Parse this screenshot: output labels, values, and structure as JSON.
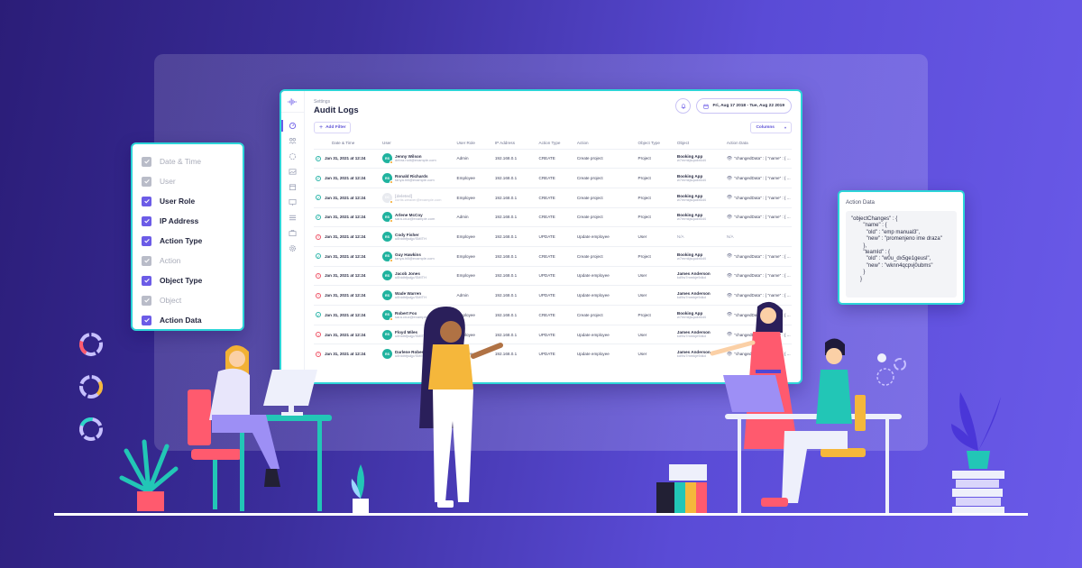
{
  "app": {
    "breadcrumb": "Settings",
    "title": "Audit Logs",
    "date_range": "Fri, Aug 17 2018 - Tue, Aug 22 2019",
    "add_filter_label": "Add Filter",
    "columns_label": "Columns",
    "sidebar_icons": [
      "dashboard-icon",
      "users-icon",
      "integrations-icon",
      "gallery-icon",
      "calendar-icon",
      "display-icon",
      "list-icon",
      "briefcase-icon",
      "settings-icon"
    ],
    "accent": "#6c5ce7",
    "status_colors": {
      "success": "#2bb5a9",
      "warning": "#ef5366"
    }
  },
  "table": {
    "columns": [
      "Date & Time",
      "User",
      "User Role",
      "IP Address",
      "Action Type",
      "Action",
      "Object Type",
      "Object",
      "Action Data"
    ],
    "rows": [
      {
        "status": "success",
        "datetime": "Jan 31, 2021 at 12:24",
        "initials": "RS",
        "user": "Jenny Wilson",
        "email": "debra.holt@example.com",
        "flag": true,
        "deleted": false,
        "role": "Admin",
        "ip": "192.168.0.1",
        "action_type": "CREATE",
        "action": "Create project",
        "object_type": "Project",
        "object": "Booking App",
        "object_id": "w7mmkjsqudx6d4",
        "action_data": "\"changedData\" : { \"name\" : { ..."
      },
      {
        "status": "success",
        "datetime": "Jan 31, 2021 at 12:24",
        "initials": "RS",
        "user": "Ronald Richards",
        "email": "tanya.hill@example.com",
        "flag": true,
        "deleted": false,
        "role": "Employee",
        "ip": "192.168.0.1",
        "action_type": "CREATE",
        "action": "Create project",
        "object_type": "Project",
        "object": "Booking App",
        "object_id": "w7mmkjsqudx6d4",
        "action_data": "\"changedData\" : { \"name\" : { ..."
      },
      {
        "status": "success",
        "datetime": "Jan 31, 2021 at 12:24",
        "initials": "DC",
        "user": "[deleted]",
        "email": "curtis.weaver@example.com",
        "flag": true,
        "deleted": true,
        "role": "Employee",
        "ip": "192.168.0.1",
        "action_type": "CREATE",
        "action": "Create project",
        "object_type": "Project",
        "object": "Booking App",
        "object_id": "w7mmkjsqudx6d4",
        "action_data": "\"changedData\" : { \"name\" : { ..."
      },
      {
        "status": "success",
        "datetime": "Jan 31, 2021 at 12:24",
        "initials": "RS",
        "user": "Arlene McCoy",
        "email": "sara.cruz@example.com",
        "flag": true,
        "deleted": false,
        "role": "Admin",
        "ip": "192.168.0.1",
        "action_type": "CREATE",
        "action": "Create project",
        "object_type": "Project",
        "object": "Booking App",
        "object_id": "w7mmkjsqudx6d4",
        "action_data": "\"changedData\" : { \"name\" : { ..."
      },
      {
        "status": "warning",
        "datetime": "Jan 31, 2021 at 12:24",
        "initials": "RS",
        "user": "Cody Fisher",
        "email": "u8hidhfjsdjp/SMITH",
        "flag": false,
        "deleted": false,
        "role": "Employee",
        "ip": "192.168.0.1",
        "action_type": "UPDATE",
        "action": "Update employee",
        "object_type": "User",
        "object": "N/A",
        "object_id": "",
        "action_data": "N/A"
      },
      {
        "status": "success",
        "datetime": "Jan 31, 2021 at 12:24",
        "initials": "RS",
        "user": "Guy Hawkins",
        "email": "tanya.hill@example.com",
        "flag": true,
        "deleted": false,
        "role": "Employee",
        "ip": "192.168.0.1",
        "action_type": "CREATE",
        "action": "Create project",
        "object_type": "Project",
        "object": "Booking App",
        "object_id": "w7mmkjsqudx6d4",
        "action_data": "\"changedData\" : { \"name\" : { ..."
      },
      {
        "status": "warning",
        "datetime": "Jan 31, 2021 at 12:24",
        "initials": "RS",
        "user": "Jacob Jones",
        "email": "u8hidhfjsdjp/SMITH",
        "flag": false,
        "deleted": false,
        "role": "Employee",
        "ip": "192.168.0.1",
        "action_type": "UPDATE",
        "action": "Update employee",
        "object_type": "User",
        "object": "James Anderson",
        "object_id": "kd9w7mmkje9dkd",
        "action_data": "\"changedData\" : { \"name\" : { ..."
      },
      {
        "status": "warning",
        "datetime": "Jan 31, 2021 at 12:24",
        "initials": "RS",
        "user": "Wade Warren",
        "email": "u8hidhfjsdjp/SMITH",
        "flag": false,
        "deleted": false,
        "role": "Admin",
        "ip": "192.168.0.1",
        "action_type": "UPDATE",
        "action": "Update employee",
        "object_type": "User",
        "object": "James Anderson",
        "object_id": "kd9w7mmkje9dkd",
        "action_data": "\"changedData\" : { \"name\" : { ..."
      },
      {
        "status": "success",
        "datetime": "Jan 31, 2021 at 12:24",
        "initials": "RS",
        "user": "Robert Fox",
        "email": "sara.cruz@example.com",
        "flag": true,
        "deleted": false,
        "role": "Employee",
        "ip": "192.168.0.1",
        "action_type": "CREATE",
        "action": "Create project",
        "object_type": "Project",
        "object": "Booking App",
        "object_id": "w7mmkjsqudx6d4",
        "action_data": "\"changedData\" : { \"name\" : { ..."
      },
      {
        "status": "warning",
        "datetime": "Jan 31, 2021 at 12:24",
        "initials": "RS",
        "user": "Floyd Miles",
        "email": "u8hidhfjsdjp/SMITH",
        "flag": false,
        "deleted": false,
        "role": "Employee",
        "ip": "192.168.0.1",
        "action_type": "UPDATE",
        "action": "Update employee",
        "object_type": "User",
        "object": "James Anderson",
        "object_id": "kd9w7mmkje9dkd",
        "action_data": "\"changedData\" : { \"name\" : { ..."
      },
      {
        "status": "warning",
        "datetime": "Jan 31, 2021 at 12:24",
        "initials": "RS",
        "user": "Darlene Robertson",
        "email": "u8hidhfjsdjp/SMITH",
        "flag": false,
        "deleted": false,
        "role": "Employee",
        "ip": "192.168.0.1",
        "action_type": "UPDATE",
        "action": "Update employee",
        "object_type": "User",
        "object": "James Anderson",
        "object_id": "kd9w7mmkje9dkd",
        "action_data": "\"changedData\" : { \"name\" : { ..."
      }
    ]
  },
  "column_picker": {
    "items": [
      {
        "label": "Date & Time",
        "checked": true,
        "disabled": true
      },
      {
        "label": "User",
        "checked": true,
        "disabled": true
      },
      {
        "label": "User Role",
        "checked": true,
        "disabled": false
      },
      {
        "label": "IP Address",
        "checked": true,
        "disabled": false
      },
      {
        "label": "Action Type",
        "checked": true,
        "disabled": false
      },
      {
        "label": "Action",
        "checked": true,
        "disabled": true
      },
      {
        "label": "Object Type",
        "checked": true,
        "disabled": false
      },
      {
        "label": "Object",
        "checked": true,
        "disabled": true
      },
      {
        "label": "Action Data",
        "checked": true,
        "disabled": false
      }
    ]
  },
  "action_data_panel": {
    "title": "Action Data",
    "code": "\"objectChanges\" : {\n        \"name\" : {\n          \"old\" : \"emp manual3\",\n          \"new\" : \"promenjeno ime draza\"\n        },\n        \"teamId\" : {\n          \"old\" : \"w0u_dx5ge1geusl\",\n          \"new\" : \"wknn4qcpvj0ubms\"\n        }\n      }"
  },
  "decor": {
    "ring_accents": [
      "#ff5a6e",
      "#f5b73b",
      "#2dd4c8"
    ]
  }
}
